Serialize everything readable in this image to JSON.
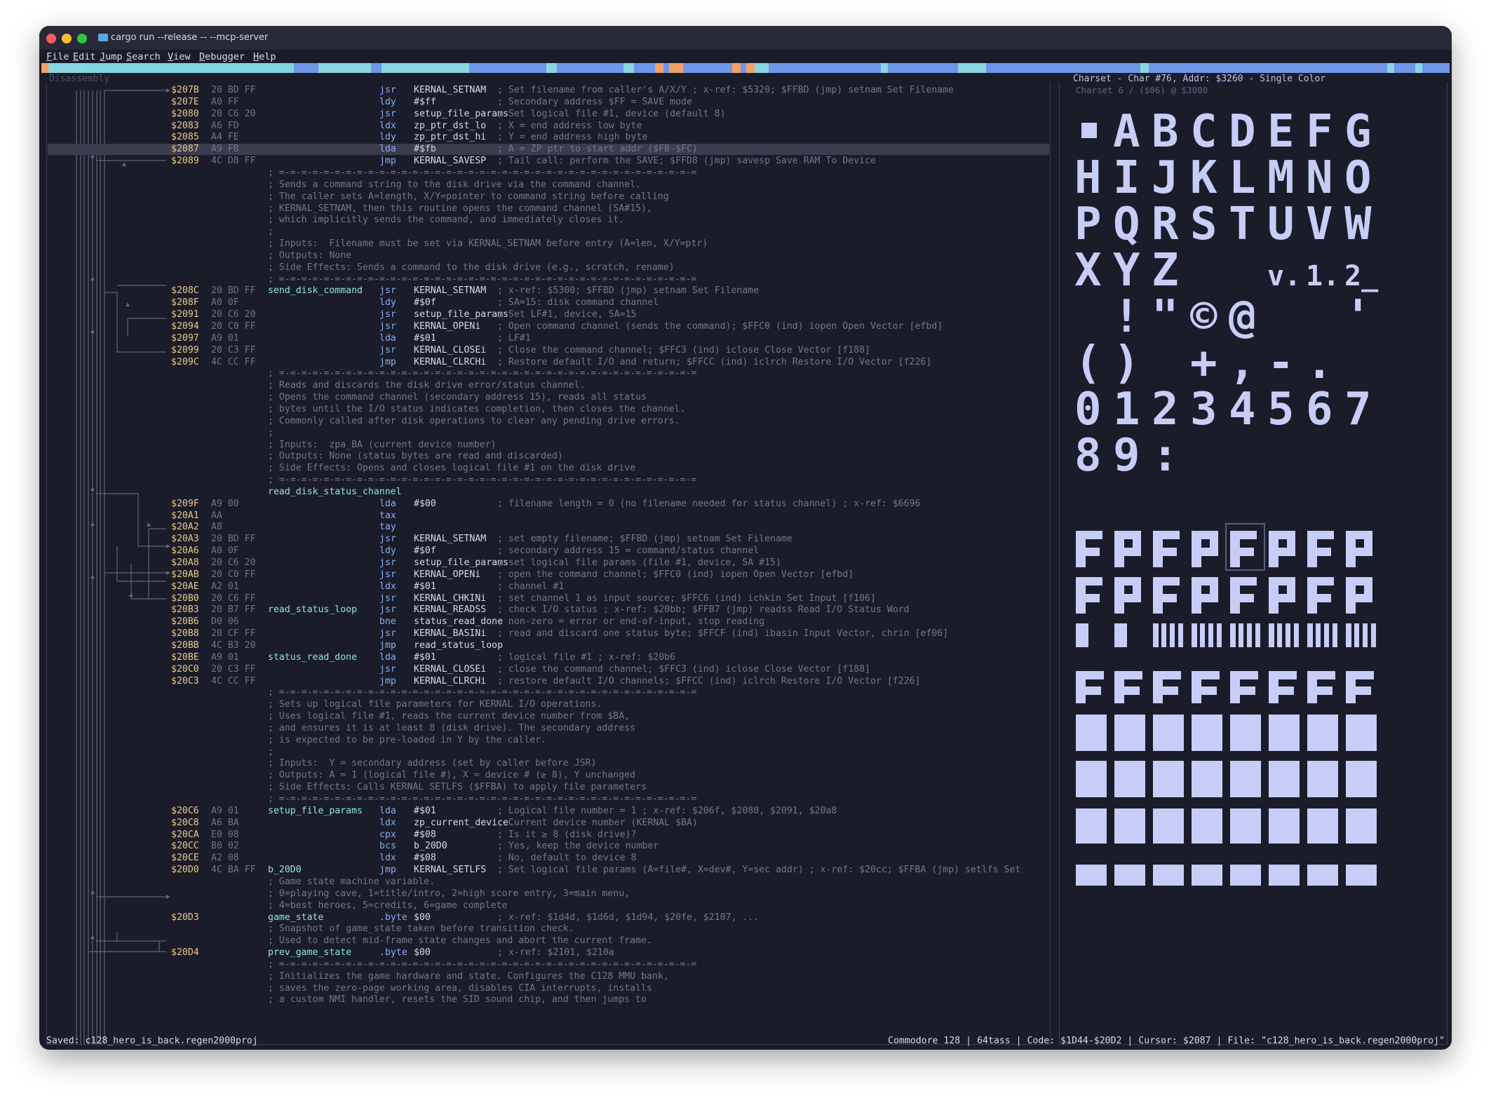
{
  "window": {
    "title": "cargo run --release -- --mcp-server"
  },
  "menu": [
    "File",
    "Edit",
    "Jump",
    "Search",
    "View",
    "Debugger",
    "Help"
  ],
  "minimap": [
    {
      "l": 0,
      "w": 10,
      "c": "#f1a06a"
    },
    {
      "l": 10,
      "w": 50,
      "c": "#8bd5e3"
    },
    {
      "l": 60,
      "w": 300,
      "c": "#7fd6e2"
    },
    {
      "l": 360,
      "w": 35,
      "c": "#6f96e8"
    },
    {
      "l": 395,
      "w": 75,
      "c": "#8bd5e3"
    },
    {
      "l": 470,
      "w": 15,
      "c": "#6f96e8"
    },
    {
      "l": 485,
      "w": 125,
      "c": "#8bd5e3"
    },
    {
      "l": 610,
      "w": 110,
      "c": "#6f96e8"
    },
    {
      "l": 720,
      "w": 15,
      "c": "#8bd5e3"
    },
    {
      "l": 735,
      "w": 95,
      "c": "#6f96e8"
    },
    {
      "l": 830,
      "w": 15,
      "c": "#8bd5e3"
    },
    {
      "l": 845,
      "w": 30,
      "c": "#6f96e8"
    },
    {
      "l": 875,
      "w": 12,
      "c": "#f1a06a"
    },
    {
      "l": 887,
      "w": 8,
      "c": "#6f96e8"
    },
    {
      "l": 895,
      "w": 20,
      "c": "#f1a06a"
    },
    {
      "l": 915,
      "w": 70,
      "c": "#6f96e8"
    },
    {
      "l": 985,
      "w": 12,
      "c": "#f1a06a"
    },
    {
      "l": 997,
      "w": 8,
      "c": "#6f96e8"
    },
    {
      "l": 1005,
      "w": 12,
      "c": "#f1a06a"
    },
    {
      "l": 1017,
      "w": 20,
      "c": "#8bd5e3"
    },
    {
      "l": 1037,
      "w": 160,
      "c": "#6f96e8"
    },
    {
      "l": 1197,
      "w": 10,
      "c": "#8bd5e3"
    },
    {
      "l": 1207,
      "w": 100,
      "c": "#6f96e8"
    },
    {
      "l": 1307,
      "w": 40,
      "c": "#8bd5e3"
    },
    {
      "l": 1347,
      "w": 220,
      "c": "#6f96e8"
    },
    {
      "l": 1567,
      "w": 12,
      "c": "#8bd5e3"
    },
    {
      "l": 1579,
      "w": 180,
      "c": "#6f96e8"
    },
    {
      "l": 1759,
      "w": 160,
      "c": "#6f96e8"
    },
    {
      "l": 1919,
      "w": 10,
      "c": "#8bd5e3"
    },
    {
      "l": 1929,
      "w": 30,
      "c": "#6f96e8"
    },
    {
      "l": 1959,
      "w": 10,
      "c": "#8bd5e3"
    },
    {
      "l": 1969,
      "w": 39,
      "c": "#6f96e8"
    }
  ],
  "disassembly": {
    "title": "Disassembly",
    "lines": [
      {
        "a": "$207B",
        "b": "20 BD FF",
        "l": "",
        "m": "jsr",
        "o": "KERNAL_SETNAM",
        "c": "; Set filename from caller's A/X/Y ; x-ref: $5320; $FFBD (jmp) setnam Set Filename"
      },
      {
        "a": "$207E",
        "b": "A0 FF",
        "l": "",
        "m": "ldy",
        "o": "#$ff",
        "c": "; Secondary address $FF = SAVE mode"
      },
      {
        "a": "$2080",
        "b": "20 C6 20",
        "l": "",
        "m": "jsr",
        "o": "setup_file_params",
        "c": "; Set logical file #1, device (default 8)"
      },
      {
        "a": "$2083",
        "b": "A6 FD",
        "l": "",
        "m": "ldx",
        "o": "zp_ptr_dst_lo",
        "c": "; X = end address low byte"
      },
      {
        "a": "$2085",
        "b": "A4 FE",
        "l": "",
        "m": "ldy",
        "o": "zp_ptr_dst_hi",
        "c": "; Y = end address high byte"
      },
      {
        "a": "$2087",
        "b": "A9 FB",
        "l": "",
        "m": "lda",
        "o": "#$fb",
        "c": "; A = ZP ptr to start addr ($FB-$FC)",
        "hl": true
      },
      {
        "a": "$2089",
        "b": "4C D8 FF",
        "l": "",
        "m": "jmp",
        "o": "KERNAL_SAVESP",
        "c": "; Tail call: perform the SAVE; $FFD8 (jmp) savesp Save RAM To Device"
      },
      {
        "t": "; =-=-=-=-=-=-=-=-=-=-=-=-=-=-=-=-=-=-=-=-=-=-=-=-=-=-=-=-=-=-=-=-=-=-=-=-=-="
      },
      {
        "t": "; Sends a command string to the disk drive via the command channel."
      },
      {
        "t": "; The caller sets A=length, X/Y=pointer to command string before calling"
      },
      {
        "t": "; KERNAL_SETNAM, then this routine opens the command channel (SA#15),"
      },
      {
        "t": "; which implicitly sends the command, and immediately closes it."
      },
      {
        "t": ";"
      },
      {
        "t": "; Inputs:  Filename must be set via KERNAL_SETNAM before entry (A=len, X/Y=ptr)"
      },
      {
        "t": "; Outputs: None"
      },
      {
        "t": "; Side Effects: Sends a command to the disk drive (e.g., scratch, rename)"
      },
      {
        "t": "; =-=-=-=-=-=-=-=-=-=-=-=-=-=-=-=-=-=-=-=-=-=-=-=-=-=-=-=-=-=-=-=-=-=-=-=-=-="
      },
      {
        "a": "$208C",
        "b": "20 BD FF",
        "l": "send_disk_command",
        "m": "jsr",
        "o": "KERNAL_SETNAM",
        "c": "; x-ref: $5300; $FFBD (jmp) setnam Set Filename"
      },
      {
        "a": "$208F",
        "b": "A0 0F",
        "l": "",
        "m": "ldy",
        "o": "#$0f",
        "c": "; SA=15: disk command channel"
      },
      {
        "a": "$2091",
        "b": "20 C6 20",
        "l": "",
        "m": "jsr",
        "o": "setup_file_params",
        "c": "; Set LF#1, device, SA=15"
      },
      {
        "a": "$2094",
        "b": "20 C0 FF",
        "l": "",
        "m": "jsr",
        "o": "KERNAL_OPENi",
        "c": "; Open command channel (sends the command); $FFC0 (ind) iopen Open Vector [efbd]"
      },
      {
        "a": "$2097",
        "b": "A9 01",
        "l": "",
        "m": "lda",
        "o": "#$01",
        "c": "; LF#1"
      },
      {
        "a": "$2099",
        "b": "20 C3 FF",
        "l": "",
        "m": "jsr",
        "o": "KERNAL_CLOSEi",
        "c": "; Close the command channel; $FFC3 (ind) iclose Close Vector [f188]"
      },
      {
        "a": "$209C",
        "b": "4C CC FF",
        "l": "",
        "m": "jmp",
        "o": "KERNAL_CLRCHi",
        "c": "; Restore default I/O and return; $FFCC (ind) iclrch Restore I/O Vector [f226]"
      },
      {
        "t": "; =-=-=-=-=-=-=-=-=-=-=-=-=-=-=-=-=-=-=-=-=-=-=-=-=-=-=-=-=-=-=-=-=-=-=-=-=-="
      },
      {
        "t": "; Reads and discards the disk drive error/status channel."
      },
      {
        "t": "; Opens the command channel (secondary address 15), reads all status"
      },
      {
        "t": "; bytes until the I/O status indicates completion, then closes the channel."
      },
      {
        "t": "; Commonly called after disk operations to clear any pending drive errors."
      },
      {
        "t": ";"
      },
      {
        "t": "; Inputs:  zpa_BA (current device number)"
      },
      {
        "t": "; Outputs: None (status bytes are read and discarded)"
      },
      {
        "t": "; Side Effects: Opens and closes logical file #1 on the disk drive"
      },
      {
        "t": "; =-=-=-=-=-=-=-=-=-=-=-=-=-=-=-=-=-=-=-=-=-=-=-=-=-=-=-=-=-=-=-=-=-=-=-=-=-="
      },
      {
        "lab": "read_disk_status_channel"
      },
      {
        "a": "$209F",
        "b": "A9 00",
        "l": "",
        "m": "lda",
        "o": "#$00",
        "c": "; filename length = 0 (no filename needed for status channel) ; x-ref: $6696"
      },
      {
        "a": "$20A1",
        "b": "AA",
        "l": "",
        "m": "tax",
        "o": "",
        "c": ""
      },
      {
        "a": "$20A2",
        "b": "A8",
        "l": "",
        "m": "tay",
        "o": "",
        "c": ""
      },
      {
        "a": "$20A3",
        "b": "20 BD FF",
        "l": "",
        "m": "jsr",
        "o": "KERNAL_SETNAM",
        "c": "; set empty filename; $FFBD (jmp) setnam Set Filename"
      },
      {
        "a": "$20A6",
        "b": "A0 0F",
        "l": "",
        "m": "ldy",
        "o": "#$0f",
        "c": "; secondary address 15 = command/status channel"
      },
      {
        "a": "$20A8",
        "b": "20 C6 20",
        "l": "",
        "m": "jsr",
        "o": "setup_file_params",
        "c": "; set logical file params (file #1, device, SA #15)"
      },
      {
        "a": "$20AB",
        "b": "20 C0 FF",
        "l": "",
        "m": "jsr",
        "o": "KERNAL_OPENi",
        "c": "; open the command channel; $FFC0 (ind) iopen Open Vector [efbd]"
      },
      {
        "a": "$20AE",
        "b": "A2 01",
        "l": "",
        "m": "ldx",
        "o": "#$01",
        "c": "; channel #1"
      },
      {
        "a": "$20B0",
        "b": "20 C6 FF",
        "l": "",
        "m": "jsr",
        "o": "KERNAL_CHKINi",
        "c": "; set channel 1 as input source; $FFC6 (ind) ichkin Set Input [f106]"
      },
      {
        "a": "$20B3",
        "b": "20 B7 FF",
        "l": "read_status_loop",
        "m": "jsr",
        "o": "KERNAL_READSS",
        "c": "; check I/O status ; x-ref: $20bb; $FFB7 (jmp) readss Read I/O Status Word"
      },
      {
        "a": "$20B6",
        "b": "D0 06",
        "l": "",
        "m": "bne",
        "o": "status_read_done",
        "c": "; non-zero = error or end-of-input, stop reading"
      },
      {
        "a": "$20B8",
        "b": "20 CF FF",
        "l": "",
        "m": "jsr",
        "o": "KERNAL_BASINi",
        "c": "; read and discard one status byte; $FFCF (ind) ibasin Input Vector, chrin [ef06]"
      },
      {
        "a": "$20BB",
        "b": "4C B3 20",
        "l": "",
        "m": "jmp",
        "o": "read_status_loop",
        "c": ""
      },
      {
        "a": "$20BE",
        "b": "A9 01",
        "l": "status_read_done",
        "m": "lda",
        "o": "#$01",
        "c": "; logical file #1 ; x-ref: $20b6"
      },
      {
        "a": "$20C0",
        "b": "20 C3 FF",
        "l": "",
        "m": "jsr",
        "o": "KERNAL_CLOSEi",
        "c": "; close the command channel; $FFC3 (ind) iclose Close Vector [f188]"
      },
      {
        "a": "$20C3",
        "b": "4C CC FF",
        "l": "",
        "m": "jmp",
        "o": "KERNAL_CLRCHi",
        "c": "; restore default I/O channels; $FFCC (ind) iclrch Restore I/O Vector [f226]"
      },
      {
        "t": "; =-=-=-=-=-=-=-=-=-=-=-=-=-=-=-=-=-=-=-=-=-=-=-=-=-=-=-=-=-=-=-=-=-=-=-=-=-="
      },
      {
        "t": "; Sets up logical file parameters for KERNAL I/O operations."
      },
      {
        "t": "; Uses logical file #1, reads the current device number from $BA,"
      },
      {
        "t": "; and ensures it is at least 8 (disk drive). The secondary address"
      },
      {
        "t": "; is expected to be pre-loaded in Y by the caller."
      },
      {
        "t": ";"
      },
      {
        "t": "; Inputs:  Y = secondary address (set by caller before JSR)"
      },
      {
        "t": "; Outputs: A = 1 (logical file #), X = device # (≥ 8), Y unchanged"
      },
      {
        "t": "; Side Effects: Calls KERNAL SETLFS ($FFBA) to apply file parameters"
      },
      {
        "t": "; =-=-=-=-=-=-=-=-=-=-=-=-=-=-=-=-=-=-=-=-=-=-=-=-=-=-=-=-=-=-=-=-=-=-=-=-=-="
      },
      {
        "a": "$20C6",
        "b": "A9 01",
        "l": "setup_file_params",
        "m": "lda",
        "o": "#$01",
        "c": "; Logical file number = 1 ; x-ref: $206f, $2080, $2091, $20a8"
      },
      {
        "a": "$20C8",
        "b": "A6 BA",
        "l": "",
        "m": "ldx",
        "o": "zp_current_device",
        "c": "; Current device number (KERNAL $BA)"
      },
      {
        "a": "$20CA",
        "b": "E0 08",
        "l": "",
        "m": "cpx",
        "o": "#$08",
        "c": "; Is it ≥ 8 (disk drive)?"
      },
      {
        "a": "$20CC",
        "b": "B0 02",
        "l": "",
        "m": "bcs",
        "o": "b_20D0",
        "c": "; Yes, keep the device number"
      },
      {
        "a": "$20CE",
        "b": "A2 08",
        "l": "",
        "m": "ldx",
        "o": "#$08",
        "c": "; No, default to device 8"
      },
      {
        "a": "$20D0",
        "b": "4C BA FF",
        "l": "b_20D0",
        "m": "jmp",
        "o": "KERNAL_SETLFS",
        "c": "; Set logical file params (A=file#, X=dev#, Y=sec addr) ; x-ref: $20cc; $FFBA (jmp) setlfs Set"
      },
      {
        "t": "; Game state machine variable."
      },
      {
        "t": "; 0=playing cave, 1=title/intro, 2=high score entry, 3=main menu,"
      },
      {
        "t": "; 4=best heroes, 5=credits, 6=game complete"
      },
      {
        "a": "$20D3",
        "b": "",
        "l": "game_state",
        "m": ".byte",
        "o": "$00",
        "c": "; x-ref: $1d4d, $1d6d, $1d94, $20fe, $2107, ..."
      },
      {
        "t": "; Snapshot of game_state taken before transition check."
      },
      {
        "t": "; Used to detect mid-frame state changes and abort the current frame."
      },
      {
        "a": "$20D4",
        "b": "",
        "l": "prev_game_state",
        "m": ".byte",
        "o": "$00",
        "c": "; x-ref: $2101, $210a"
      },
      {
        "t": "; =-=-=-=-=-=-=-=-=-=-=-=-=-=-=-=-=-=-=-=-=-=-=-=-=-=-=-=-=-=-=-=-=-=-=-=-=-="
      },
      {
        "t": "; Initializes the game hardware and state. Configures the C128 MMU bank,"
      },
      {
        "t": "; saves the zero-page working area, disables CIA interrupts, installs"
      },
      {
        "t": "; a custom NMI handler, resets the SID sound chip, and then jumps to"
      }
    ]
  },
  "charset": {
    "title": "Charset - Char #76, Addr: $3260 - Single Color",
    "subtitle": "Charset  6 / ($06) @ $3000",
    "glyph_rows": [
      {
        "row": 0,
        "chars": [
          "▪",
          "A",
          "B",
          "C",
          "D",
          "E",
          "F",
          "G"
        ]
      },
      {
        "row": 1,
        "chars": [
          "H",
          "I",
          "J",
          "K",
          "L",
          "M",
          "N",
          "O"
        ]
      },
      {
        "row": 2,
        "chars": [
          "P",
          "Q",
          "R",
          "S",
          "T",
          "U",
          "V",
          "W"
        ]
      },
      {
        "row": 3,
        "chars": [
          "X",
          "Y",
          "Z",
          "",
          "",
          "v.",
          "1.",
          "2_"
        ]
      },
      {
        "row": 4,
        "chars": [
          "",
          "!",
          "\"",
          "©",
          "@",
          "",
          "",
          "'"
        ]
      },
      {
        "row": 5,
        "chars": [
          "(",
          ")",
          "",
          "+",
          ",",
          "-",
          ".",
          ""
        ]
      },
      {
        "row": 6,
        "chars": [
          "0",
          "1",
          "2",
          "3",
          "4",
          "5",
          "6",
          "7"
        ]
      },
      {
        "row": 7,
        "chars": [
          "8",
          "9",
          ":",
          "",
          "",
          "",
          "",
          ""
        ]
      }
    ],
    "selected_index": 76
  },
  "status": {
    "left": "Saved: c128_hero_is_back.regen2000proj",
    "right": "Commodore 128 | 64tass | Code: $1D44-$20D2 | Cursor: $2087 | File: \"c128_hero_is_back.regen2000proj\""
  },
  "colors": {
    "accent": "#85aef6",
    "label": "#8ce6d8",
    "address": "#e8c88a",
    "glyph": "#c6cdf7"
  }
}
